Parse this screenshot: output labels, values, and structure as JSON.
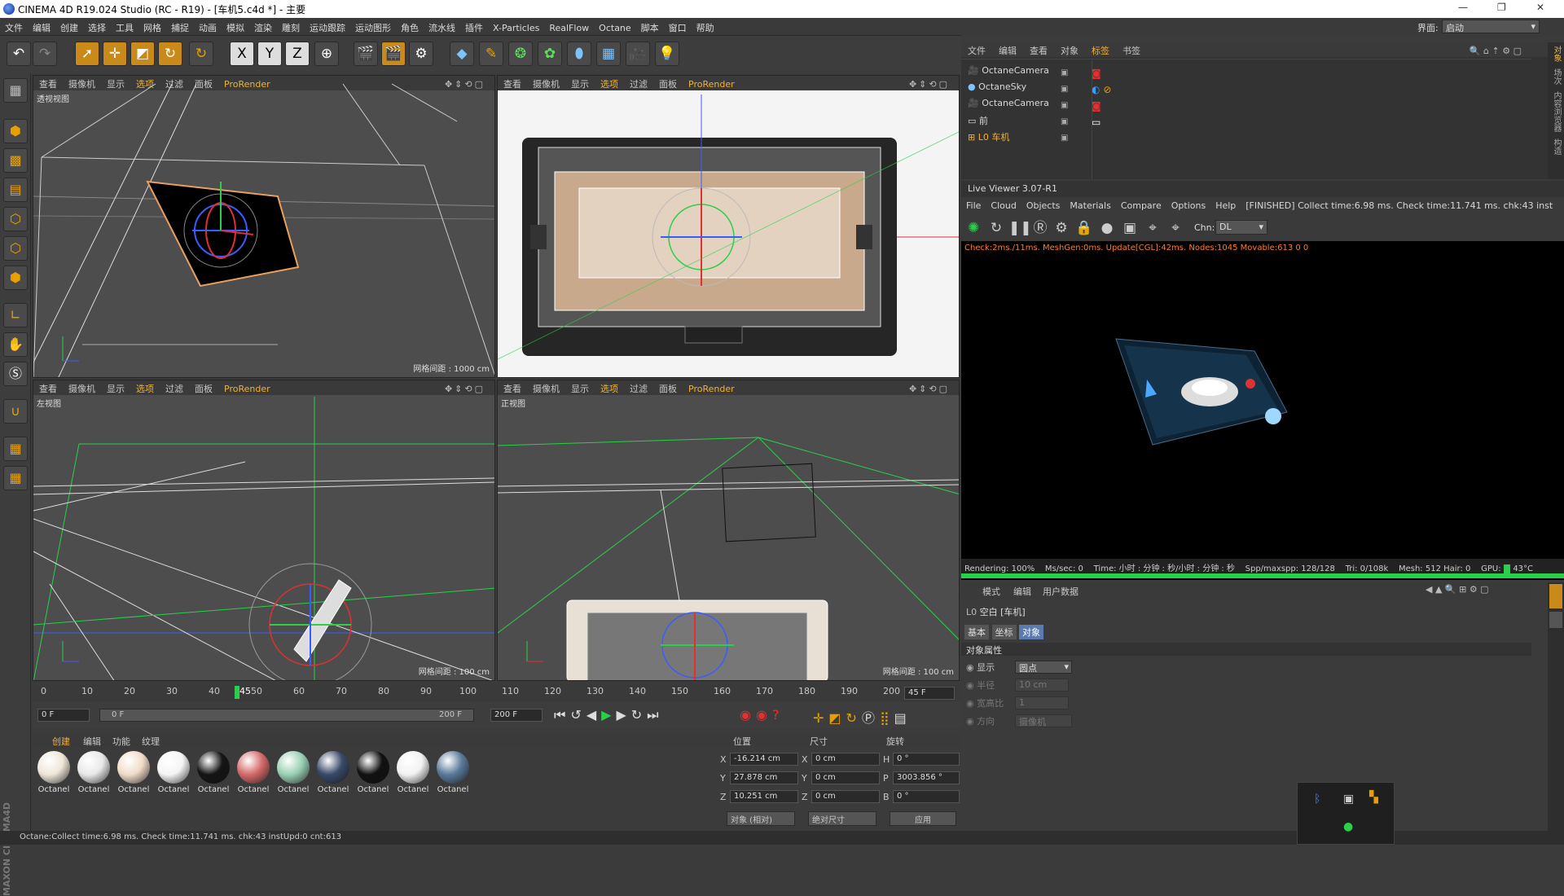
{
  "app": {
    "title": "CINEMA 4D R19.024 Studio (RC - R19) - [车机5.c4d *] - 主要",
    "interface_label": "界面:",
    "interface_value": "启动"
  },
  "menu": [
    "文件",
    "编辑",
    "创建",
    "选择",
    "工具",
    "网格",
    "捕捉",
    "动画",
    "模拟",
    "渲染",
    "雕刻",
    "运动跟踪",
    "运动图形",
    "角色",
    "流水线",
    "插件",
    "X-Particles",
    "RealFlow",
    "Octane",
    "脚本",
    "窗口",
    "帮助"
  ],
  "viewport_menu": [
    "查看",
    "摄像机",
    "显示",
    "选项",
    "过滤",
    "面板",
    "ProRender"
  ],
  "viewports": [
    {
      "name": "透视视图",
      "grid": "网格间距 : 1000 cm"
    },
    {
      "name": "",
      "grid": ""
    },
    {
      "name": "左视图",
      "grid": "网格间距 : 100 cm"
    },
    {
      "name": "正视图",
      "grid": "网格间距 : 100 cm"
    }
  ],
  "object_manager": {
    "tabs": [
      "文件",
      "编辑",
      "查看",
      "对象",
      "标签",
      "书签"
    ],
    "objects": [
      "OctaneCamera",
      "OctaneSky",
      "OctaneCamera",
      "前",
      "车机"
    ]
  },
  "right_tabs": [
    "对象",
    "场次",
    "内容浏览器",
    "构造"
  ],
  "live_viewer": {
    "title": "Live Viewer 3.07-R1",
    "menu": [
      "File",
      "Cloud",
      "Objects",
      "Materials",
      "Compare",
      "Options",
      "Help"
    ],
    "finished": "[FINISHED] Collect time:6.98 ms.  Check time:11.741 ms.  chk:43  inst",
    "chn_label": "Chn:",
    "chn_value": "DL",
    "info": "Check:2ms./11ms. MeshGen:0ms. Update[CGL]:42ms. Nodes:1045 Movable:613  0 0",
    "status": {
      "rendering": "Rendering: 100%",
      "ms": "Ms/sec: 0",
      "time": "Time: 小时 : 分钟 : 秒/小时 : 分钟 : 秒",
      "spp": "Spp/maxspp: 128/128",
      "tri": "Tri: 0/108k",
      "mesh": "Mesh: 512  Hair: 0",
      "gpu": "GPU:",
      "temp": "43°C"
    }
  },
  "attributes": {
    "tabs": [
      "模式",
      "编辑",
      "用户数据"
    ],
    "object_title": "空白 [车机]",
    "subtabs": [
      "基本",
      "坐标",
      "对象"
    ],
    "section": "对象属性",
    "rows": [
      {
        "label": "显示",
        "value": "圆点"
      },
      {
        "label": "半径",
        "value": "10 cm"
      },
      {
        "label": "宽高比",
        "value": "1"
      },
      {
        "label": "方向",
        "value": "摄像机"
      }
    ]
  },
  "timeline": {
    "ticks": [
      "0",
      "10",
      "20",
      "30",
      "40",
      "45",
      "50",
      "60",
      "70",
      "80",
      "90",
      "100",
      "110",
      "120",
      "130",
      "140",
      "150",
      "160",
      "170",
      "180",
      "190",
      "200"
    ],
    "current": "45 F",
    "start": "0 F",
    "range_start": "0 F",
    "range_end": "200 F",
    "end": "200 F"
  },
  "materials": {
    "tabs": [
      "创建",
      "编辑",
      "功能",
      "纹理"
    ],
    "items": [
      {
        "label": "Octanel",
        "color": "#efe6d8"
      },
      {
        "label": "Octanel",
        "color": "#e8e8e8"
      },
      {
        "label": "Octanel",
        "color": "#f0dcc8"
      },
      {
        "label": "Octanel",
        "color": "#f5f5f5"
      },
      {
        "label": "Octanel",
        "color": "#151515"
      },
      {
        "label": "Octanel",
        "color": "#d46a6a"
      },
      {
        "label": "Octanel",
        "color": "#9ad0b4"
      },
      {
        "label": "Octanel",
        "color": "#3a4a6a"
      },
      {
        "label": "Octanel",
        "color": "#111111"
      },
      {
        "label": "Octanel",
        "color": "#f2f2f2"
      },
      {
        "label": "Octanel",
        "color": "#5a7a9a"
      }
    ]
  },
  "coordinates": {
    "headers": [
      "位置",
      "尺寸",
      "旋转"
    ],
    "rows": [
      {
        "axis": "X",
        "pos": "-16.214 cm",
        "size_axis": "X",
        "size": "0 cm",
        "rot_axis": "H",
        "rot": "0 °"
      },
      {
        "axis": "Y",
        "pos": "27.878 cm",
        "size_axis": "Y",
        "size": "0 cm",
        "rot_axis": "P",
        "rot": "3003.856 °"
      },
      {
        "axis": "Z",
        "pos": "10.251 cm",
        "size_axis": "Z",
        "size": "0 cm",
        "rot_axis": "B",
        "rot": "0 °"
      }
    ],
    "mode1": "对象 (相对)",
    "mode2": "绝对尺寸",
    "apply": "应用"
  },
  "statusbar": "Octane:Collect time:6.98 ms.  Check time:11.741 ms.  chk:43  instUpd:0  cnt:613",
  "colors": {
    "accent": "#f2b233",
    "green": "#2ad04a",
    "orange": "#ff7a2a"
  }
}
